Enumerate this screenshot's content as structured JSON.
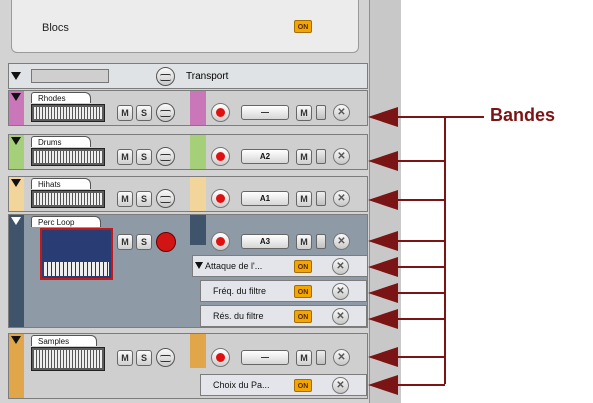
{
  "blocs": {
    "label": "Blocs",
    "on": "ON"
  },
  "transport": {
    "label": "Transport"
  },
  "tracks": [
    {
      "name": "Rhodes",
      "mute": "M",
      "solo": "S",
      "patch": "—",
      "mute2": "M"
    },
    {
      "name": "Drums",
      "mute": "M",
      "solo": "S",
      "patch": "A2",
      "mute2": "M"
    },
    {
      "name": "Hihats",
      "mute": "M",
      "solo": "S",
      "patch": "A1",
      "mute2": "M"
    },
    {
      "name": "Perc Loop",
      "mute": "M",
      "solo": "S",
      "patch": "A3",
      "mute2": "M"
    },
    {
      "name": "Samples",
      "mute": "M",
      "solo": "S",
      "patch": "—",
      "mute2": "M"
    }
  ],
  "automation": [
    {
      "label": "Attaque de l'...",
      "on": "ON"
    },
    {
      "label": "Fréq. du filtre",
      "on": "ON"
    },
    {
      "label": "Rés. du filtre",
      "on": "ON"
    },
    {
      "label": "Choix du Pa...",
      "on": "ON"
    }
  ],
  "annotation": {
    "label": "Bandes",
    "color": "#7b1414"
  },
  "colors": {
    "rhodes": "#c977b8",
    "drums": "#a6cf7a",
    "hihats": "#f1d59a",
    "perc": "#3f536b",
    "samples": "#e1a64a"
  }
}
